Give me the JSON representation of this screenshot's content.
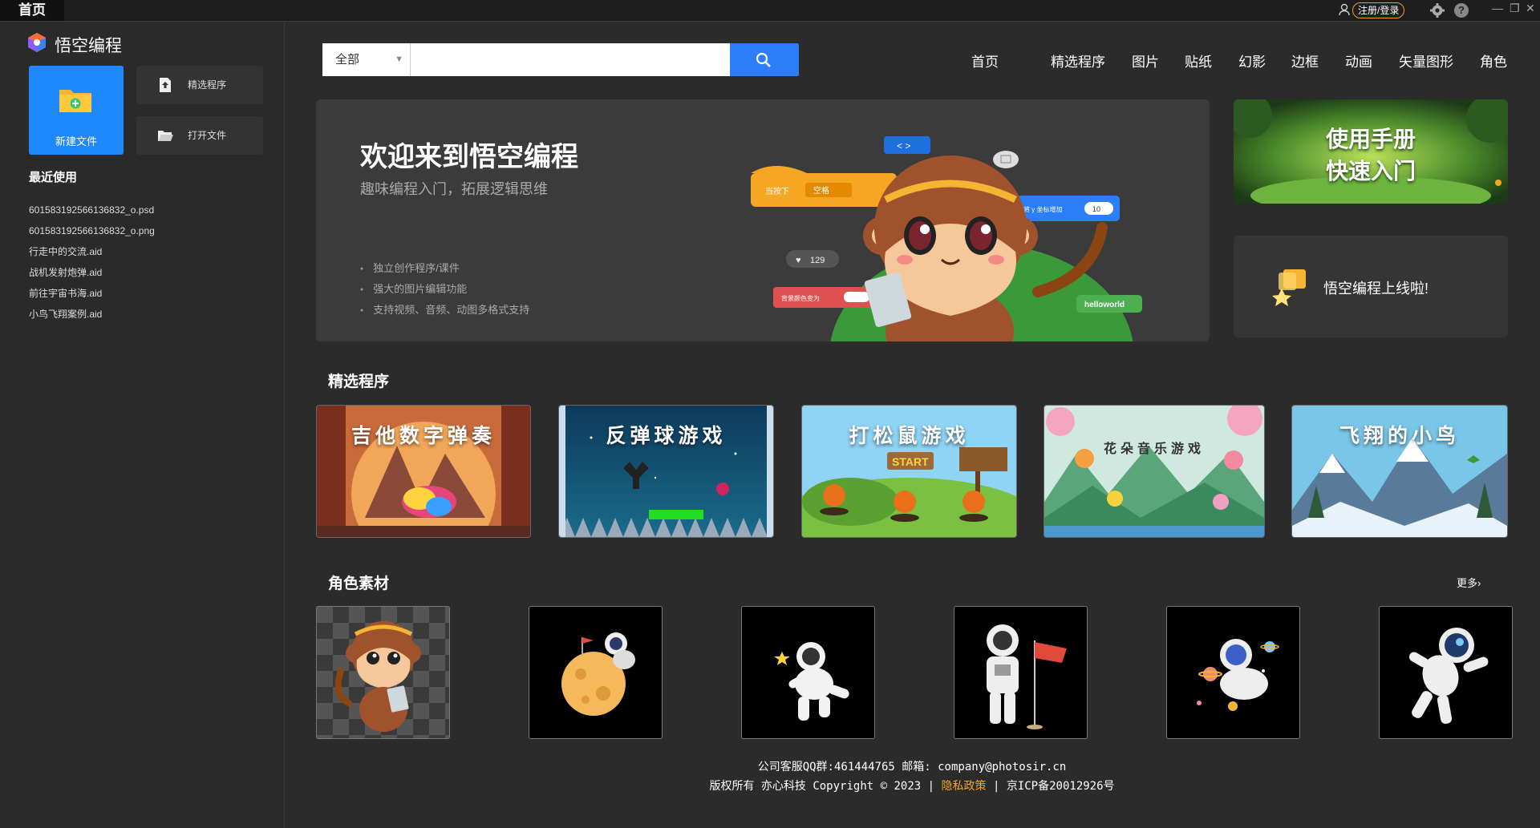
{
  "titlebar": {
    "tab": "首页",
    "login": "注册/登录",
    "help": "?",
    "win_min": "—",
    "win_max": "❐",
    "win_close": "✕"
  },
  "sidebar": {
    "app_title": "悟空编程",
    "new_file": "新建文件",
    "featured_btn": "精选程序",
    "open_file_btn": "打开文件",
    "recent_title": "最近使用",
    "recent": [
      "601583192566136832_o.psd",
      "601583192566136832_o.png",
      "行走中的交流.aid",
      "战机发射炮弹.aid",
      "前往宇宙书海.aid",
      "小鸟飞翔案例.aid"
    ]
  },
  "search": {
    "scope": "全部",
    "value": "",
    "placeholder": ""
  },
  "nav": [
    "首页",
    "精选程序",
    "图片",
    "贴纸",
    "幻影",
    "边框",
    "动画",
    "矢量图形",
    "角色"
  ],
  "banner": {
    "title": "欢迎来到悟空编程",
    "subtitle": "趣味编程入门，拓展逻辑思维",
    "features": [
      "独立创作程序/课件",
      "强大的图片编辑功能",
      "支持视频、音频、动图多格式支持"
    ],
    "block_key_label": "当按下",
    "block_key_value": "空格",
    "block_y_label": "将 y 坐标增加",
    "block_y_value": "10",
    "code_tag": "< >",
    "likes": "129",
    "bg_color_label": "背景颜色变为",
    "helloworld": "helloworld"
  },
  "side_cards": {
    "manual_line1": "使用手册",
    "manual_line2": "快速入门",
    "online": "悟空编程上线啦!"
  },
  "featured": {
    "title": "精选程序",
    "items": [
      {
        "title": "吉他数字弹奏"
      },
      {
        "title": "反弹球游戏"
      },
      {
        "title": "打松鼠游戏",
        "sign": "START"
      },
      {
        "title": "花朵音乐游戏"
      },
      {
        "title": "飞翔的小鸟"
      }
    ]
  },
  "characters": {
    "title": "角色素材",
    "more": "更多›"
  },
  "footer": {
    "line1": "公司客服QQ群:461444765 邮箱: company@photosir.cn",
    "copyright": "版权所有 亦心科技 Copyright © 2023",
    "sep": "|",
    "privacy": "隐私政策",
    "icp": "京ICP备20012926号"
  },
  "colors": {
    "accent": "#2c7ef8",
    "new_file_bg": "#1e88ff",
    "privacy": "#f5a623",
    "login_border": "#f0a020"
  }
}
